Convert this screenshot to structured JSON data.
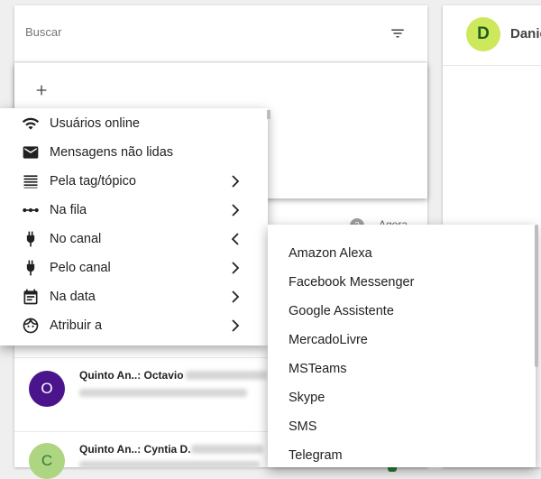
{
  "search": {
    "placeholder": "Buscar"
  },
  "icons": {
    "filter": "filter-list-icon",
    "add": "plus-icon"
  },
  "chat_header": {
    "avatar_letter": "D",
    "contact_name": "Danie"
  },
  "conversations": [
    {
      "avatar_letter": "O",
      "avatar_color": "#4a148c",
      "title": "Quinto An..: Octavio"
    },
    {
      "avatar_letter": "C",
      "avatar_color": "#aed581",
      "title": "Quinto An..: Cyntia D."
    }
  ],
  "partial_row": {
    "badge": "2",
    "time": "Agora"
  },
  "filter_menu": {
    "items": [
      {
        "label": "Usuários online",
        "icon": "wifi-icon",
        "submenu": false
      },
      {
        "label": "Mensagens não lidas",
        "icon": "mail-icon",
        "submenu": false
      },
      {
        "label": "Pela tag/tópico",
        "icon": "list-lines-icon",
        "submenu": true,
        "chevron": "right"
      },
      {
        "label": "Na fila",
        "icon": "queue-dots-icon",
        "submenu": true,
        "chevron": "right"
      },
      {
        "label": "No canal",
        "icon": "plug-icon",
        "submenu": true,
        "chevron": "left"
      },
      {
        "label": "Pelo canal",
        "icon": "plug-icon",
        "submenu": true,
        "chevron": "right"
      },
      {
        "label": "Na data",
        "icon": "calendar-icon",
        "submenu": true,
        "chevron": "right"
      },
      {
        "label": "Atribuir a",
        "icon": "face-icon",
        "submenu": true,
        "chevron": "right"
      }
    ]
  },
  "channel_submenu": {
    "items": [
      "Amazon Alexa",
      "Facebook Messenger",
      "Google Assistente",
      "MercadoLivre",
      "MSTeams",
      "Skype",
      "SMS",
      "Telegram"
    ]
  },
  "colors": {
    "accent": "#4a148c",
    "avatar_d_bg": "#cde85b"
  }
}
